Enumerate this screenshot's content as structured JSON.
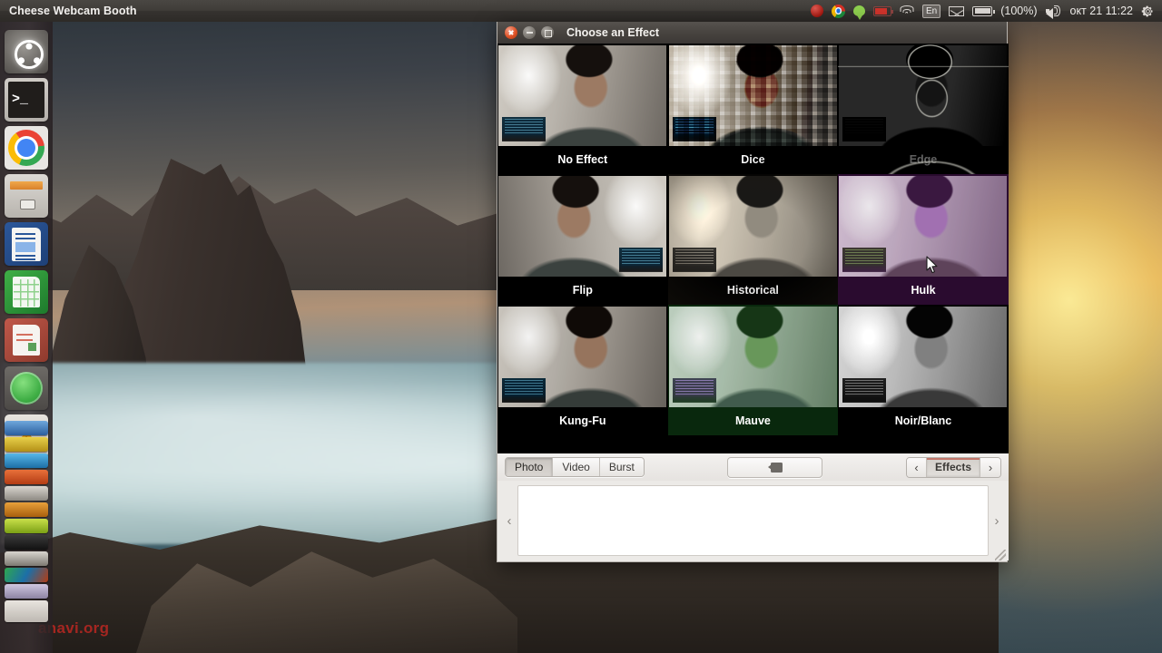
{
  "panel": {
    "title": "Cheese Webcam Booth",
    "tray": {
      "items": [
        {
          "name": "ubuntu-one-icon",
          "label": ""
        },
        {
          "name": "chrome-indicator-icon",
          "label": ""
        },
        {
          "name": "messages-bubble-icon",
          "label": ""
        },
        {
          "name": "battery-low-icon",
          "label": ""
        },
        {
          "name": "wifi-icon",
          "label": ""
        },
        {
          "name": "keyboard-layout-indicator",
          "label": "En"
        },
        {
          "name": "mail-icon",
          "label": ""
        },
        {
          "name": "battery-icon",
          "label": ""
        }
      ],
      "keyboard_layout": "En",
      "battery_percent": "(100%)",
      "clock": "окт 21 11:22"
    }
  },
  "launcher": {
    "items": [
      {
        "name": "sidebar-item-dash",
        "label": "Ubuntu Dash"
      },
      {
        "name": "sidebar-item-terminal",
        "label": "Terminal"
      },
      {
        "name": "sidebar-item-chrome",
        "label": "Google Chrome"
      },
      {
        "name": "sidebar-item-files",
        "label": "Files"
      },
      {
        "name": "sidebar-item-writer",
        "label": "LibreOffice Writer"
      },
      {
        "name": "sidebar-item-calc",
        "label": "LibreOffice Calc"
      },
      {
        "name": "sidebar-item-impress",
        "label": "LibreOffice Impress"
      },
      {
        "name": "sidebar-item-software",
        "label": "Ubuntu Software Center"
      },
      {
        "name": "sidebar-item-xchat",
        "label": "XChat"
      }
    ]
  },
  "dialog": {
    "title": "Choose an Effect",
    "window_buttons": {
      "close": "Close",
      "minimize": "Minimize",
      "maximize": "Maximize"
    },
    "effects": [
      [
        {
          "id": "none",
          "label": "No Effect"
        },
        {
          "id": "dice",
          "label": "Dice"
        },
        {
          "id": "edge",
          "label": "Edge"
        }
      ],
      [
        {
          "id": "flip",
          "label": "Flip"
        },
        {
          "id": "historical",
          "label": "Historical"
        },
        {
          "id": "hulk",
          "label": "Hulk"
        }
      ],
      [
        {
          "id": "kungfu",
          "label": "Kung-Fu"
        },
        {
          "id": "mauve",
          "label": "Mauve"
        },
        {
          "id": "noir",
          "label": "Noir/Blanc"
        }
      ]
    ]
  },
  "toolbar": {
    "modes": [
      {
        "label": "Photo",
        "active": true
      },
      {
        "label": "Video",
        "active": false
      },
      {
        "label": "Burst",
        "active": false
      }
    ],
    "capture_icon": "camera-icon",
    "effects_prev": "‹",
    "effects_label": "Effects",
    "effects_next": "›"
  },
  "gallery": {
    "prev": "‹",
    "next": "›",
    "items": []
  },
  "desktop": {
    "watermark": "anavi.org"
  }
}
